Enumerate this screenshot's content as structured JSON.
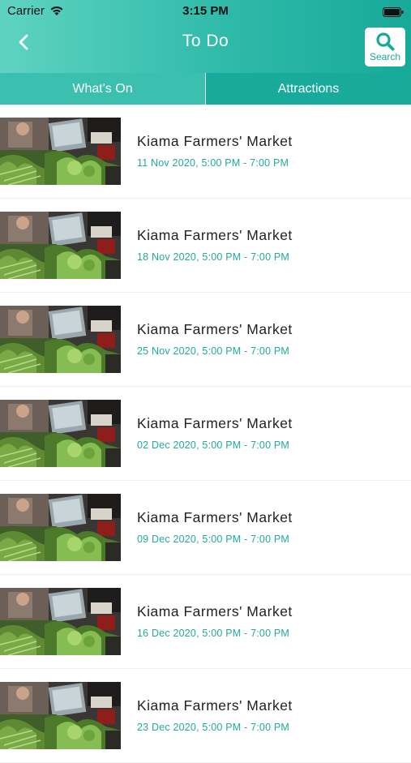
{
  "status_bar": {
    "carrier": "Carrier",
    "time": "3:15 PM"
  },
  "header": {
    "title": "To Do",
    "search_label": "Search",
    "accent_color": "#1aa999"
  },
  "tabs": [
    {
      "label": "What's On",
      "selected": true
    },
    {
      "label": "Attractions",
      "selected": false
    }
  ],
  "events": [
    {
      "title": "Kiama Farmers' Market",
      "date": "11 Nov 2020, 5:00 PM - 7:00 PM"
    },
    {
      "title": "Kiama Farmers' Market",
      "date": "18 Nov 2020, 5:00 PM - 7:00 PM"
    },
    {
      "title": "Kiama Farmers' Market",
      "date": "25 Nov 2020, 5:00 PM - 7:00 PM"
    },
    {
      "title": "Kiama Farmers' Market",
      "date": "02 Dec 2020, 5:00 PM - 7:00 PM"
    },
    {
      "title": "Kiama Farmers' Market",
      "date": "09 Dec 2020, 5:00 PM - 7:00 PM"
    },
    {
      "title": "Kiama Farmers' Market",
      "date": "16 Dec 2020, 5:00 PM - 7:00 PM"
    },
    {
      "title": "Kiama Farmers' Market",
      "date": "23 Dec 2020, 5:00 PM - 7:00 PM"
    }
  ]
}
